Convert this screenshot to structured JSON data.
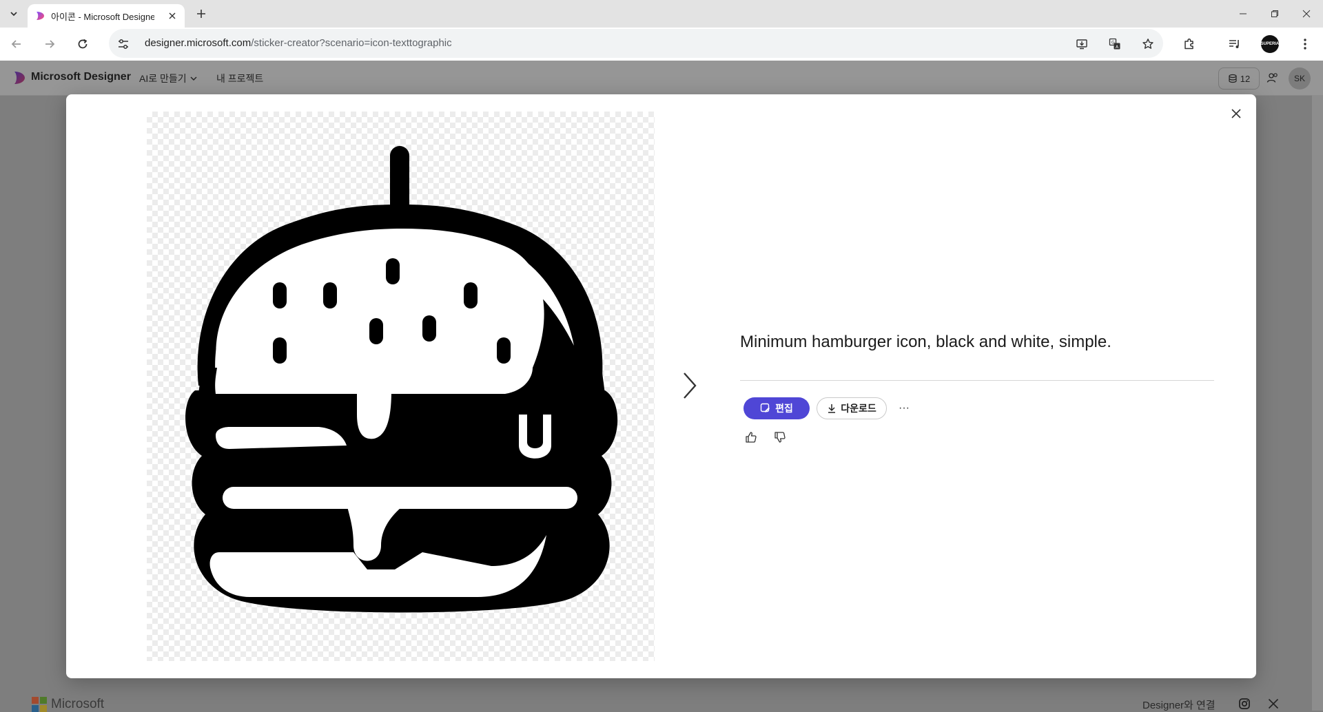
{
  "browser": {
    "tab_title": "아이콘 - Microsoft Designer",
    "url_host": "designer.microsoft.com",
    "url_path": "/sticker-creator?scenario=icon-texttographic",
    "profile_label": "SUPERIA"
  },
  "app_header": {
    "brand": "Microsoft Designer",
    "menu_ai": "AI로 만들기",
    "menu_projects": "내 프로젝트",
    "credits": "12",
    "avatar": "SK"
  },
  "modal": {
    "prompt": "Minimum hamburger icon, black and white, simple.",
    "edit_label": "편집",
    "download_label": "다운로드",
    "more_label": "···"
  },
  "footer": {
    "company": "Microsoft",
    "connect": "Designer와 연결"
  },
  "colors": {
    "accent": "#4f46d6",
    "overlay": "#7e7e7e"
  },
  "icons": {
    "preview_image": "hamburger-icon"
  }
}
